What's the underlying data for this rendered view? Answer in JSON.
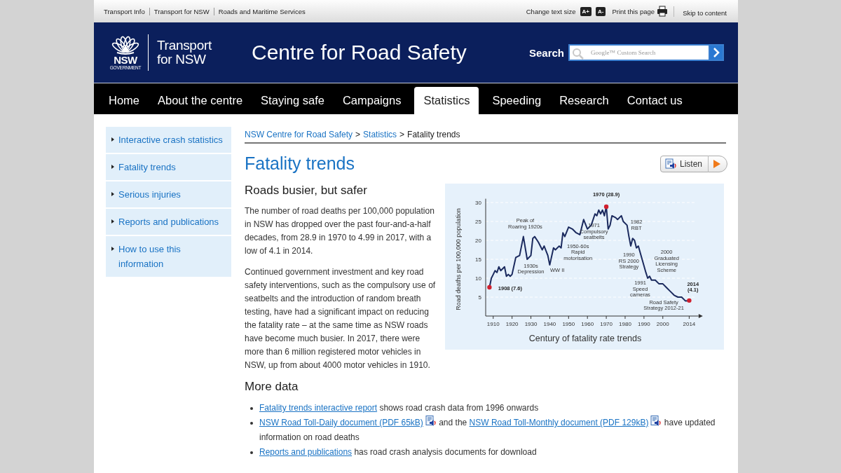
{
  "utility_bar": {
    "links": [
      "Transport Info",
      "Transport for NSW",
      "Roads and Maritime Services"
    ],
    "text_size_label": "Change text size",
    "text_size_buttons": [
      "A+",
      "A-"
    ],
    "print_label": "Print this page",
    "skip_link": "Skip to content"
  },
  "header": {
    "logo": {
      "wordmark": "NSW",
      "sub": "GOVERNMENT",
      "agency": [
        "Transport",
        "for NSW"
      ]
    },
    "title": "Centre for Road Safety",
    "search": {
      "label": "Search",
      "placeholder": "Google™ Custom Search"
    }
  },
  "nav": [
    {
      "label": "Home",
      "selected": false
    },
    {
      "label": "About the centre",
      "selected": false
    },
    {
      "label": "Staying safe",
      "selected": false
    },
    {
      "label": "Campaigns",
      "selected": false
    },
    {
      "label": "Statistics",
      "selected": true
    },
    {
      "label": "Speeding",
      "selected": false
    },
    {
      "label": "Research",
      "selected": false
    },
    {
      "label": "Contact us",
      "selected": false
    }
  ],
  "sidebar": {
    "items": [
      "Interactive crash statistics",
      "Fatality trends",
      "Serious injuries",
      "Reports and publications",
      "How to use this information"
    ]
  },
  "breadcrumb": {
    "links": [
      "NSW Centre for Road Safety",
      "Statistics"
    ],
    "separator": ">",
    "current": "Fatality trends"
  },
  "page_title": "Fatality trends",
  "listen_button": "Listen",
  "section_title": "Roads busier, but safer",
  "paragraphs": [
    "The number of road deaths per 100,000 population in NSW has dropped over the past four-and-a-half decades, from 28.9 in 1970 to 4.99 in 2017, with a low of 4.1 in 2014.",
    "Continued government investment and key road safety interventions, such as the compulsory use of seatbelts and the introduction of random breath testing, have had a significant impact on reducing the fatality rate – at the same time as NSW roads have become much busier. In 2017, there were more than 6 million registered motor vehicles in NSW, up from about 4000 motor vehicles in 1910."
  ],
  "figure": {
    "chart_data": {
      "type": "line",
      "title": "Century of fatality rate trends",
      "ylabel": "Road deaths per 100,000 population",
      "grid": true,
      "xlim": [
        1906,
        2019
      ],
      "ylim": [
        0,
        31
      ],
      "xticks": [
        1910,
        1920,
        1930,
        1940,
        1950,
        1960,
        1970,
        1980,
        1990,
        2000,
        2014
      ],
      "yticks": [
        5,
        10,
        15,
        20,
        25,
        30
      ],
      "x": [
        1908,
        1909,
        1910,
        1911,
        1912,
        1913,
        1914,
        1916,
        1917,
        1918,
        1919,
        1920,
        1922,
        1924,
        1926,
        1928,
        1930,
        1931,
        1932,
        1934,
        1936,
        1937,
        1939,
        1940,
        1942,
        1943,
        1945,
        1946,
        1947,
        1948,
        1950,
        1952,
        1954,
        1956,
        1958,
        1960,
        1962,
        1964,
        1965,
        1966,
        1967,
        1968,
        1969,
        1970,
        1971,
        1972,
        1973,
        1975,
        1976,
        1978,
        1979,
        1981,
        1982,
        1983,
        1984,
        1985,
        1986,
        1987,
        1989,
        1991,
        1992,
        1993,
        1994,
        1996,
        1998,
        2000,
        2002,
        2004,
        2006,
        2008,
        2010,
        2012,
        2014
      ],
      "series": [
        {
          "color": "#1b2a5e",
          "values": [
            7.6,
            10,
            11,
            12,
            11.5,
            13,
            12,
            13,
            10.5,
            11,
            10.5,
            11,
            15.5,
            16,
            21,
            15,
            16,
            20.5,
            21,
            19.5,
            17.5,
            18.5,
            16,
            13.5,
            18,
            17.5,
            18.5,
            18,
            22,
            21,
            23.5,
            23,
            22,
            21.5,
            25.5,
            23,
            24,
            27,
            26.5,
            28,
            27,
            28,
            26.5,
            28.9,
            23,
            24,
            26.5,
            26,
            25.5,
            26.5,
            25,
            24,
            21,
            18.5,
            20.5,
            20,
            18,
            18.5,
            15,
            11.5,
            10,
            10.5,
            9.5,
            9.5,
            8.5,
            8.5,
            7.5,
            6.5,
            5.5,
            5,
            5,
            4,
            4.1
          ]
        }
      ],
      "annotations": [
        "1970 (28.9)",
        "1908 (7.6)",
        "2014\n(4.1)",
        "Peak of\nRoaring 1920s",
        "1930s\nDepression",
        "WW II",
        "1950-60s\nRapid\nmotorisation",
        "1971\nCompulsory\nseatbelts",
        "1982\nRBT",
        "1990\nRS 2000\nStrategy",
        "2000\nGraduated\nLicensing\nScheme",
        "1991\nSpeed\ncameras",
        "Road Safety\nStrategy 2012-21"
      ]
    }
  },
  "more_data": {
    "title": "More data",
    "items": [
      [
        {
          "kind": "link",
          "text": "Fatality trends interactive report"
        },
        {
          "kind": "text",
          "text": " shows road crash data from 1996 onwards"
        }
      ],
      [
        {
          "kind": "link",
          "text": "NSW Road Toll-Daily document (PDF 65kB)"
        },
        {
          "kind": "audio-icon"
        },
        {
          "kind": "text",
          "text": " and the "
        },
        {
          "kind": "link",
          "text": "NSW Road Toll-Monthly document (PDF 129kB)"
        },
        {
          "kind": "audio-icon"
        },
        {
          "kind": "text",
          "text": " have updated information on road deaths"
        }
      ],
      [
        {
          "kind": "link",
          "text": "Reports and publications"
        },
        {
          "kind": "text",
          "text": " has road crash analysis documents for download"
        }
      ]
    ]
  }
}
